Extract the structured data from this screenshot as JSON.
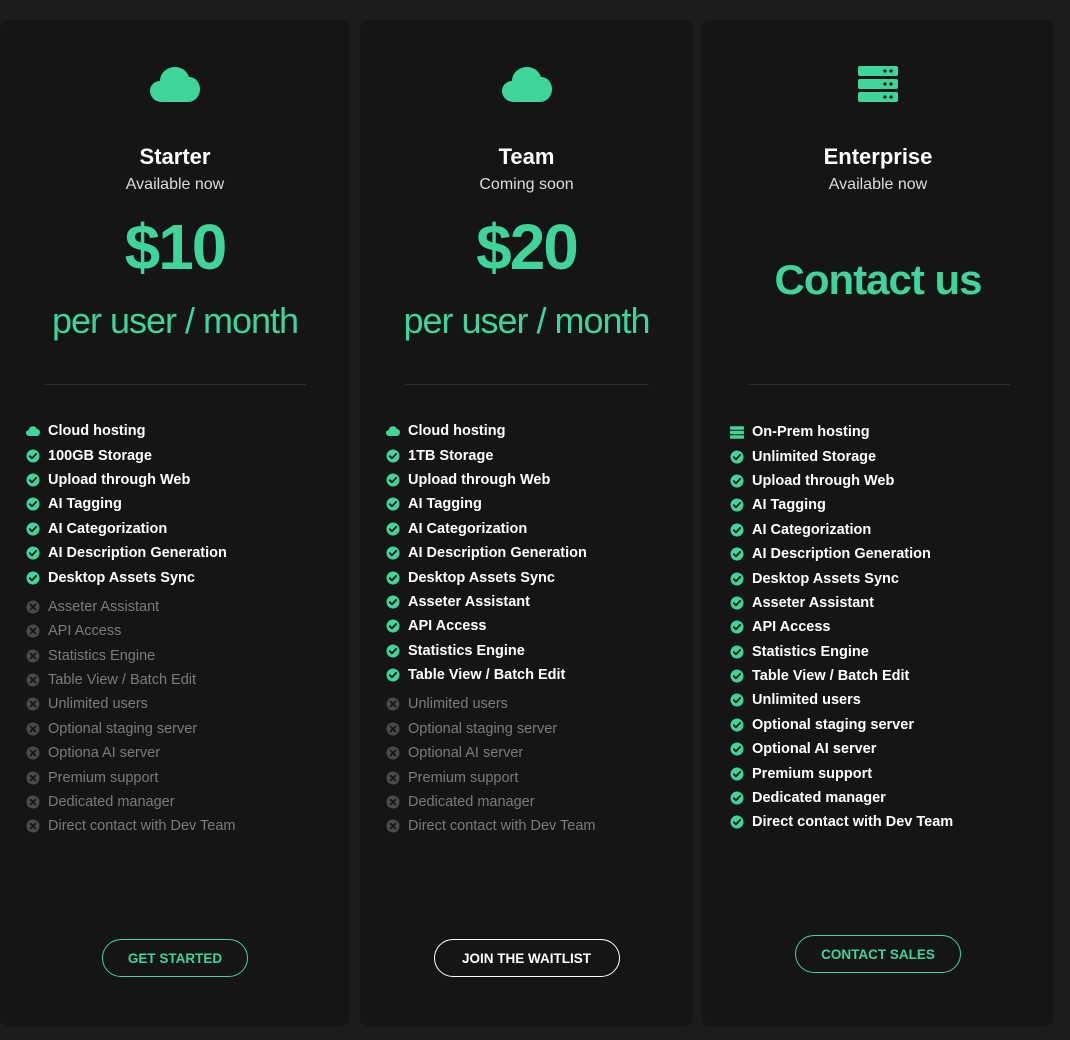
{
  "plans": [
    {
      "name": "Starter",
      "availability": "Available now",
      "price": "$10",
      "period": "per user / month",
      "hero_icon": "cloud-icon",
      "button": "GET STARTED",
      "features_included": [
        {
          "label": "Cloud hosting",
          "icon": "cloud-icon"
        },
        {
          "label": "100GB Storage",
          "icon": "check-circle-icon"
        },
        {
          "label": "Upload through Web",
          "icon": "check-circle-icon"
        },
        {
          "label": "AI Tagging",
          "icon": "check-circle-icon"
        },
        {
          "label": "AI Categorization",
          "icon": "check-circle-icon"
        },
        {
          "label": "AI Description Generation",
          "icon": "check-circle-icon"
        },
        {
          "label": "Desktop Assets Sync",
          "icon": "check-circle-icon"
        }
      ],
      "features_excluded": [
        "Asseter Assistant",
        "API Access",
        "Statistics Engine",
        "Table View / Batch Edit",
        "Unlimited users",
        "Optional staging server",
        "Optiona AI server",
        "Premium support",
        "Dedicated manager",
        "Direct contact with Dev Team"
      ]
    },
    {
      "name": "Team",
      "availability": "Coming soon",
      "price": "$20",
      "period": "per user / month",
      "hero_icon": "cloud-icon",
      "button": "JOIN THE WAITLIST",
      "features_included": [
        {
          "label": "Cloud hosting",
          "icon": "cloud-icon"
        },
        {
          "label": "1TB Storage",
          "icon": "check-circle-icon"
        },
        {
          "label": "Upload through Web",
          "icon": "check-circle-icon"
        },
        {
          "label": "AI Tagging",
          "icon": "check-circle-icon"
        },
        {
          "label": "AI Categorization",
          "icon": "check-circle-icon"
        },
        {
          "label": "AI Description Generation",
          "icon": "check-circle-icon"
        },
        {
          "label": "Desktop Assets Sync",
          "icon": "check-circle-icon"
        },
        {
          "label": "Asseter Assistant",
          "icon": "check-circle-icon"
        },
        {
          "label": "API Access",
          "icon": "check-circle-icon"
        },
        {
          "label": "Statistics Engine",
          "icon": "check-circle-icon"
        },
        {
          "label": "Table View / Batch Edit",
          "icon": "check-circle-icon"
        }
      ],
      "features_excluded": [
        "Unlimited users",
        "Optional staging server",
        "Optional AI server",
        "Premium support",
        "Dedicated manager",
        "Direct contact with Dev Team"
      ]
    },
    {
      "name": "Enterprise",
      "availability": "Available now",
      "contact": "Contact us",
      "hero_icon": "server-icon",
      "button": "CONTACT SALES",
      "features_included": [
        {
          "label": "On-Prem hosting",
          "icon": "server-icon"
        },
        {
          "label": "Unlimited Storage",
          "icon": "check-circle-icon"
        },
        {
          "label": "Upload through Web",
          "icon": "check-circle-icon"
        },
        {
          "label": "AI Tagging",
          "icon": "check-circle-icon"
        },
        {
          "label": "AI Categorization",
          "icon": "check-circle-icon"
        },
        {
          "label": "AI Description Generation",
          "icon": "check-circle-icon"
        },
        {
          "label": "Desktop Assets Sync",
          "icon": "check-circle-icon"
        },
        {
          "label": "Asseter Assistant",
          "icon": "check-circle-icon"
        },
        {
          "label": "API Access",
          "icon": "check-circle-icon"
        },
        {
          "label": "Statistics Engine",
          "icon": "check-circle-icon"
        },
        {
          "label": "Table View / Batch Edit",
          "icon": "check-circle-icon"
        },
        {
          "label": "Unlimited users",
          "icon": "check-circle-icon"
        },
        {
          "label": "Optional staging server",
          "icon": "check-circle-icon"
        },
        {
          "label": "Optional AI server",
          "icon": "check-circle-icon"
        },
        {
          "label": "Premium support",
          "icon": "check-circle-icon"
        },
        {
          "label": "Dedicated manager",
          "icon": "check-circle-icon"
        },
        {
          "label": "Direct contact with Dev Team",
          "icon": "check-circle-icon"
        }
      ],
      "features_excluded": []
    }
  ],
  "colors": {
    "accent": "#3fd59a",
    "page_bg": "#1c1c1c",
    "card_bg": "#151515",
    "excluded_text": "#7b7b7b",
    "excluded_icon": "#4a4a4a"
  }
}
